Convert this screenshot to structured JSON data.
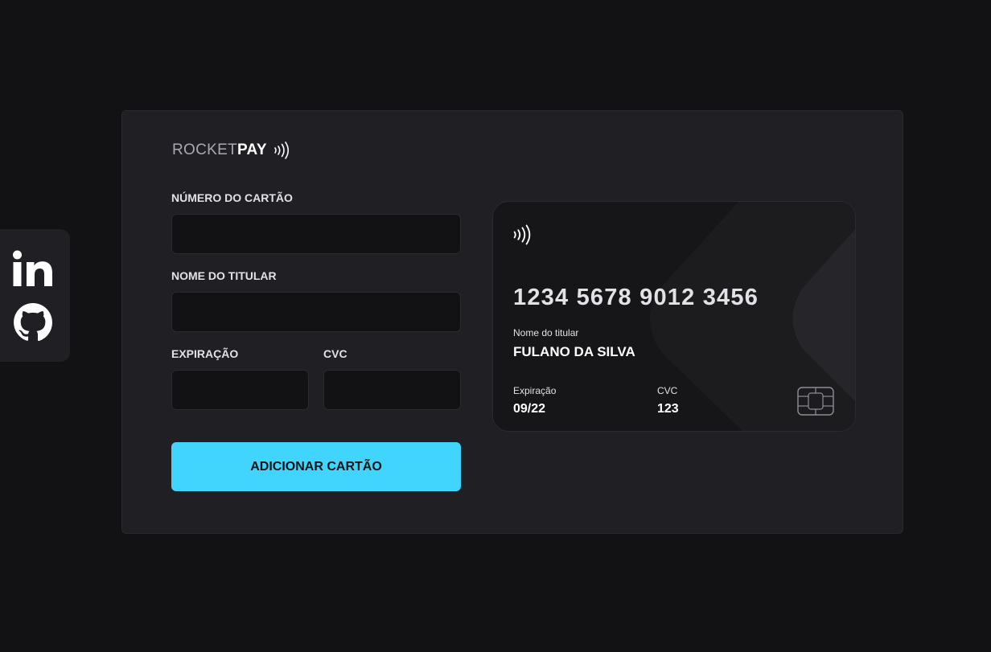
{
  "social": {
    "linkedin_icon": "linkedin-icon",
    "github_icon": "github-icon"
  },
  "logo": {
    "part1": "ROCKET",
    "part2": "PAY",
    "icon": "contactless-icon"
  },
  "form": {
    "card_number": {
      "label": "NÚMERO DO CARTÃO",
      "value": "",
      "placeholder": ""
    },
    "holder_name": {
      "label": "NOME DO TITULAR",
      "value": "",
      "placeholder": ""
    },
    "expiration": {
      "label": "EXPIRAÇÃO",
      "value": "",
      "placeholder": ""
    },
    "cvc": {
      "label": "CVC",
      "value": "",
      "placeholder": ""
    },
    "submit_label": "ADICIONAR CARTÃO"
  },
  "card": {
    "number": "1234 5678 9012 3456",
    "holder_label": "Nome do titular",
    "holder": "FULANO DA SILVA",
    "exp_label": "Expiração",
    "exp": "09/22",
    "cvc_label": "CVC",
    "cvc": "123",
    "contactless_icon": "contactless-icon",
    "chip_icon": "chip-icon"
  },
  "colors": {
    "background": "#121214",
    "panel": "#202024",
    "accent": "#41d5fd",
    "text": "#e1e1e6"
  }
}
